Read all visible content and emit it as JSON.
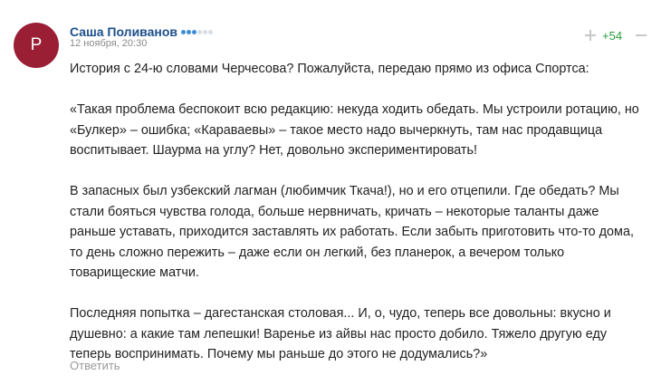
{
  "comment": {
    "avatar_letter": "P",
    "avatar_color": "#9a1f35",
    "author": "Саша Поливанов",
    "rating_dots": {
      "filled": 3,
      "total": 6
    },
    "timestamp": "12 ноября, 20:30",
    "score": "+54",
    "score_color": "#2c9f3a",
    "paragraphs": [
      [
        "История с 24-ю словами Черчесова? Пожалуйста, передаю прямо из офиса Спортса:"
      ],
      [
        "«Такая проблема беспокоит всю редакцию: некуда ходить обедать. Мы устроили ротацию, но",
        "«Булкер» – ошибка; «Караваевы» – такое место надо вычеркнуть, там нас продавщица",
        "воспитывает. Шаурма на углу? Нет, довольно экспериментировать!"
      ],
      [
        "В запасных был узбекский лагман (любимчик Ткача!), но и его отцепили. Где обедать? Мы",
        "стали бояться чувства голода, больше нервничать, кричать – некоторые таланты даже",
        "раньше уставать, приходится заставлять их работать. Если забыть приготовить что-то дома,",
        "то день сложно пережить – даже если он легкий, без планерок, а вечером только",
        "товарищеские матчи."
      ],
      [
        "Последняя попытка – дагестанская столовая... И, о, чудо, теперь все довольны: вкусно и",
        "душевно: а какие там лепешки! Варенье из айвы нас просто добило. Тяжело другую еду",
        "теперь воспринимать. Почему мы раньше до этого не додумались?»"
      ]
    ],
    "reply_label": "Ответить"
  },
  "icons": {
    "upvote": "plus-icon",
    "downvote": "minus-icon"
  }
}
